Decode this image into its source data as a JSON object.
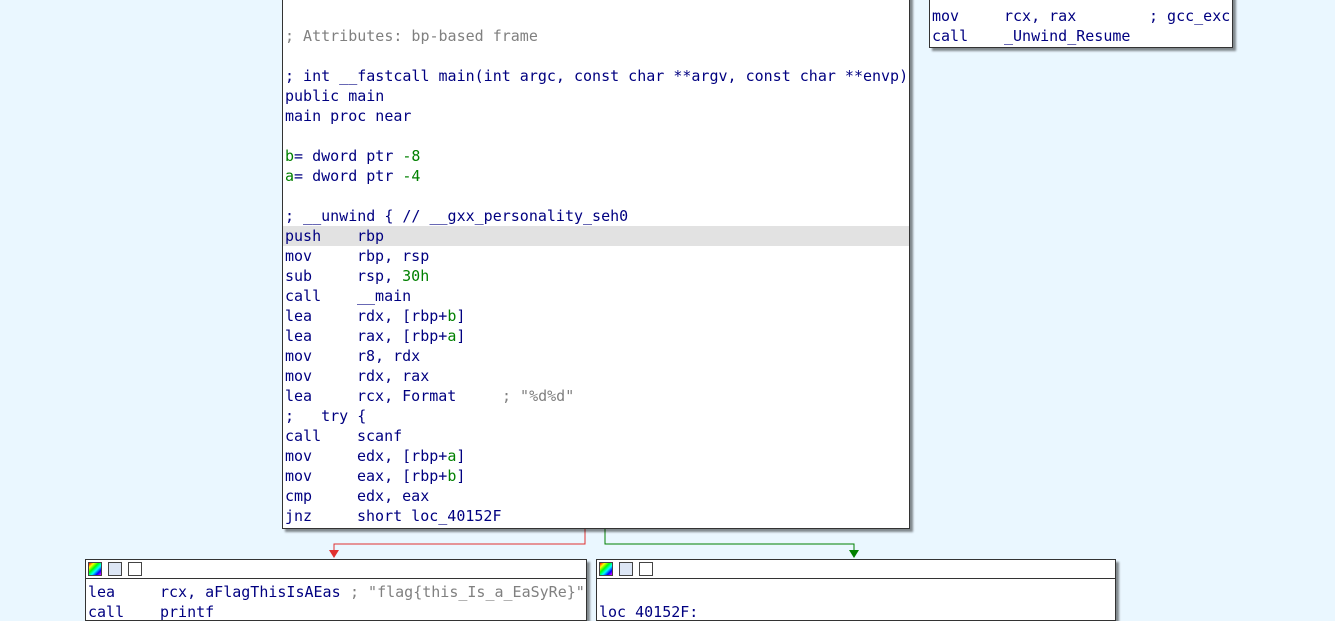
{
  "right_block": {
    "lines": [
      {
        "mnem": "mov",
        "ops": "rcx, rax",
        "comment": "; gcc_exc"
      },
      {
        "mnem": "call",
        "ops": "_Unwind_Resume",
        "comment": ""
      }
    ]
  },
  "main_block": {
    "attributes": "; Attributes: bp-based frame",
    "signature": "; int __fastcall main(int argc, const char **argv, const char **envp)",
    "public": "public main",
    "proc": "main proc near",
    "var_b_name": "b",
    "var_b_def": "= dword ptr ",
    "var_b_val": "-8",
    "var_a_name": "a",
    "var_a_def": "= dword ptr ",
    "var_a_val": "-4",
    "unwind": "; __unwind { // __gxx_personality_seh0",
    "instructions": [
      {
        "mnem": "push",
        "ops": "rbp"
      },
      {
        "mnem": "mov",
        "ops": "rbp, rsp"
      },
      {
        "mnem": "sub",
        "ops": "rsp, ",
        "imm": "30h"
      },
      {
        "mnem": "call",
        "ops": "__main"
      },
      {
        "mnem": "lea",
        "ops": "rdx, [rbp+",
        "var": "b",
        "close": "]"
      },
      {
        "mnem": "lea",
        "ops": "rax, [rbp+",
        "var": "a",
        "close": "]"
      },
      {
        "mnem": "mov",
        "ops": "r8, rdx"
      },
      {
        "mnem": "mov",
        "ops": "rdx, rax"
      },
      {
        "mnem": "lea",
        "ops": "rcx, Format",
        "comment": "; \"%d%d\""
      }
    ],
    "try_line": ";   try {",
    "instructions2": [
      {
        "mnem": "call",
        "ops": "scanf"
      },
      {
        "mnem": "mov",
        "ops": "edx, [rbp+",
        "var": "a",
        "close": "]"
      },
      {
        "mnem": "mov",
        "ops": "eax, [rbp+",
        "var": "b",
        "close": "]"
      },
      {
        "mnem": "cmp",
        "ops": "edx, eax"
      },
      {
        "mnem": "jnz",
        "ops": "short loc_40152F"
      }
    ]
  },
  "left_bottom_block": {
    "line1_mnem": "lea",
    "line1_ops": "rcx, aFlagThisIsAEas",
    "line1_comment": "; \"flag{this_Is_a_EaSyRe}\"",
    "line2_mnem": "call",
    "line2_ops": "printf"
  },
  "right_bottom_block": {
    "label": "loc_40152F:"
  },
  "colors": {
    "background": "#eaf7ff",
    "false_edge": "#e03030",
    "true_edge": "#008000",
    "text_blue": "#000080",
    "comment_gray": "#808080",
    "value_green": "#008000"
  },
  "icons": [
    "color-palette-icon",
    "edit-icon",
    "graph-icon"
  ]
}
